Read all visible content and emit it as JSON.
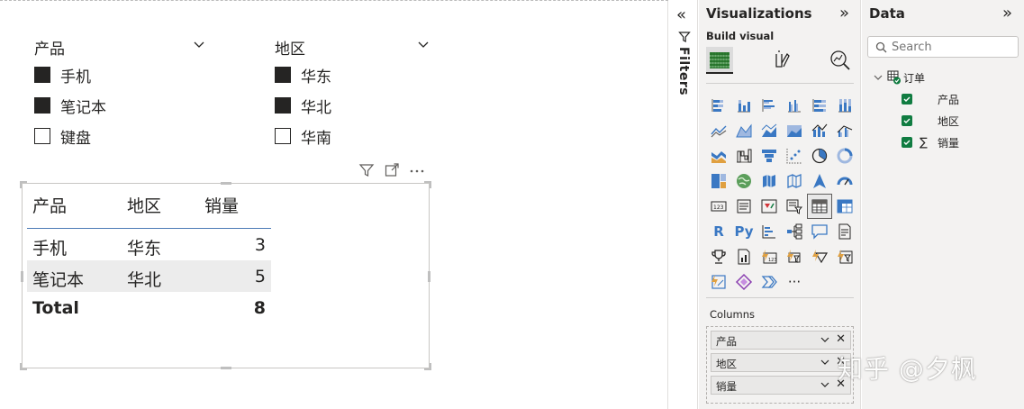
{
  "slicers": [
    {
      "title": "产品",
      "items": [
        {
          "label": "手机",
          "checked": true
        },
        {
          "label": "笔记本",
          "checked": true
        },
        {
          "label": "键盘",
          "checked": false
        }
      ]
    },
    {
      "title": "地区",
      "items": [
        {
          "label": "华东",
          "checked": true
        },
        {
          "label": "华北",
          "checked": true
        },
        {
          "label": "华南",
          "checked": false
        }
      ]
    }
  ],
  "table": {
    "headers": [
      "产品",
      "地区",
      "销量"
    ],
    "rows": [
      [
        "手机",
        "华东",
        "3"
      ],
      [
        "笔记本",
        "华北",
        "5"
      ]
    ],
    "total": {
      "label": "Total",
      "value": "8"
    }
  },
  "filters_pane": {
    "label": "Filters",
    "collapse_glyph": "«"
  },
  "visualizations_pane": {
    "title": "Visualizations",
    "expand_glyph": "»",
    "subtitle": "Build visual",
    "more_glyph": "···",
    "r_label": "R",
    "py_label": "Py",
    "columns_label": "Columns",
    "wells": [
      "产品",
      "地区",
      "销量"
    ],
    "remove_glyph": "✕"
  },
  "data_pane": {
    "title": "Data",
    "expand_glyph": "»",
    "search_placeholder": "Search",
    "table_name": "订单",
    "fields": [
      {
        "name": "产品",
        "sigma": false
      },
      {
        "name": "地区",
        "sigma": false
      },
      {
        "name": "销量",
        "sigma": true
      }
    ],
    "sigma_glyph": "∑"
  },
  "watermark": "知乎 @夕枫",
  "colors": {
    "accent": "#107c41",
    "header_rule": "#4c7ab6",
    "pane_bg": "#f3f2f1",
    "icon_blue": "#3a78c3"
  }
}
